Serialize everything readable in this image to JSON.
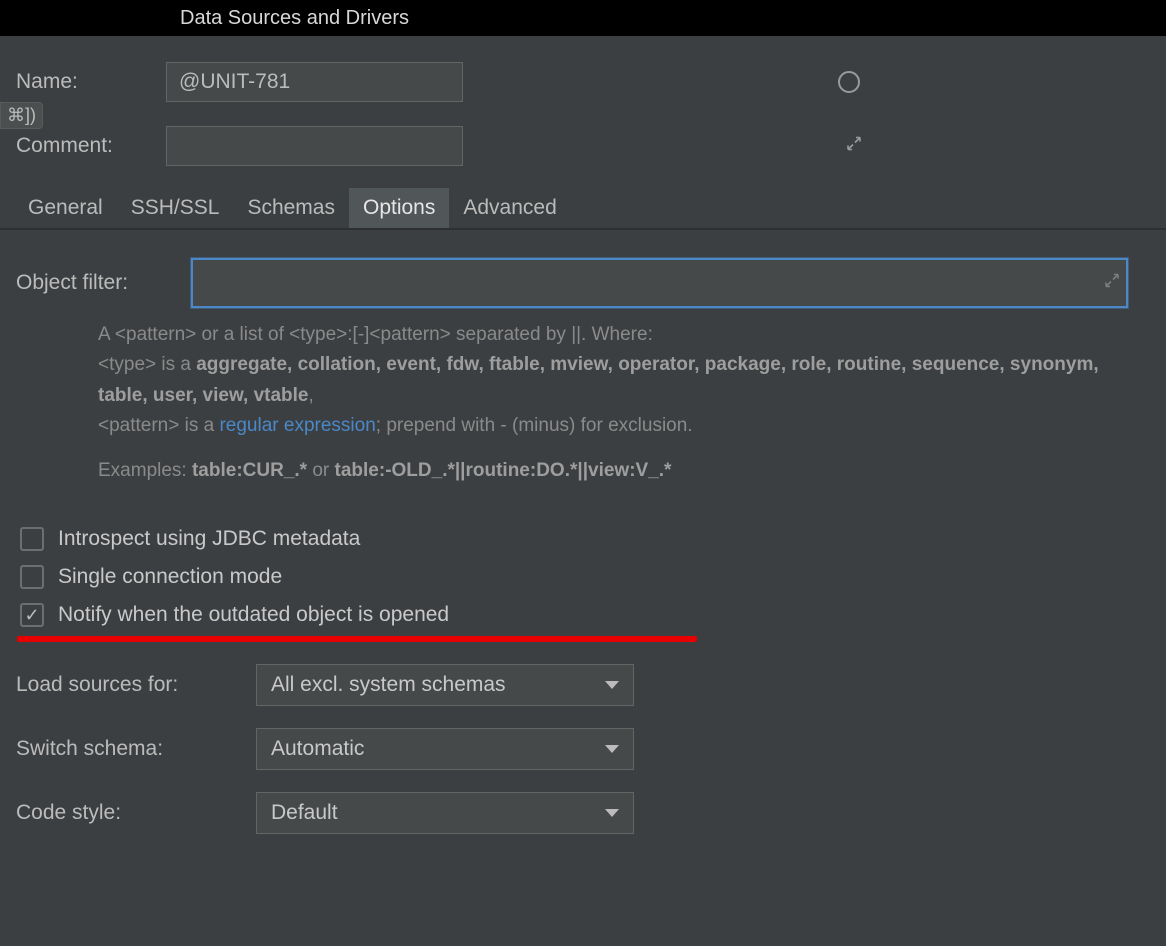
{
  "titlebar": "Data Sources and Drivers",
  "shortcut_badge": "⌘])",
  "form": {
    "name_label": "Name:",
    "name_value": "@UNIT-781",
    "comment_label": "Comment:",
    "comment_value": ""
  },
  "tabs": {
    "general": "General",
    "ssh": "SSH/SSL",
    "schemas": "Schemas",
    "options": "Options",
    "advanced": "Advanced",
    "active": "options"
  },
  "filter": {
    "label": "Object filter:",
    "value": ""
  },
  "help": {
    "line1_pre": "A <pattern> or a list of <type>:[-]<pattern> separated by ||. Where:",
    "line2_pre": "<type> is a ",
    "types": "aggregate, collation, event, fdw, ftable, mview, operator, package, role, routine, sequence, synonym, table, user, view, vtable",
    "line3_pre": "<pattern> is a ",
    "link": "regular expression",
    "line3_post": "; prepend with - (minus) for exclusion.",
    "examples_label": "Examples: ",
    "ex1": "table:CUR_.*",
    "ex_or": " or ",
    "ex2": "table:-OLD_.*||routine:DO.*||view:V_.*"
  },
  "checks": {
    "introspect": {
      "label": "Introspect using JDBC metadata",
      "checked": false
    },
    "single": {
      "label": "Single connection mode",
      "checked": false
    },
    "notify": {
      "label": "Notify when the outdated object is opened",
      "checked": true
    }
  },
  "selects": {
    "load_label": "Load sources for:",
    "load_value": "All excl. system schemas",
    "switch_label": "Switch schema:",
    "switch_value": "Automatic",
    "code_label": "Code style:",
    "code_value": "Default"
  }
}
